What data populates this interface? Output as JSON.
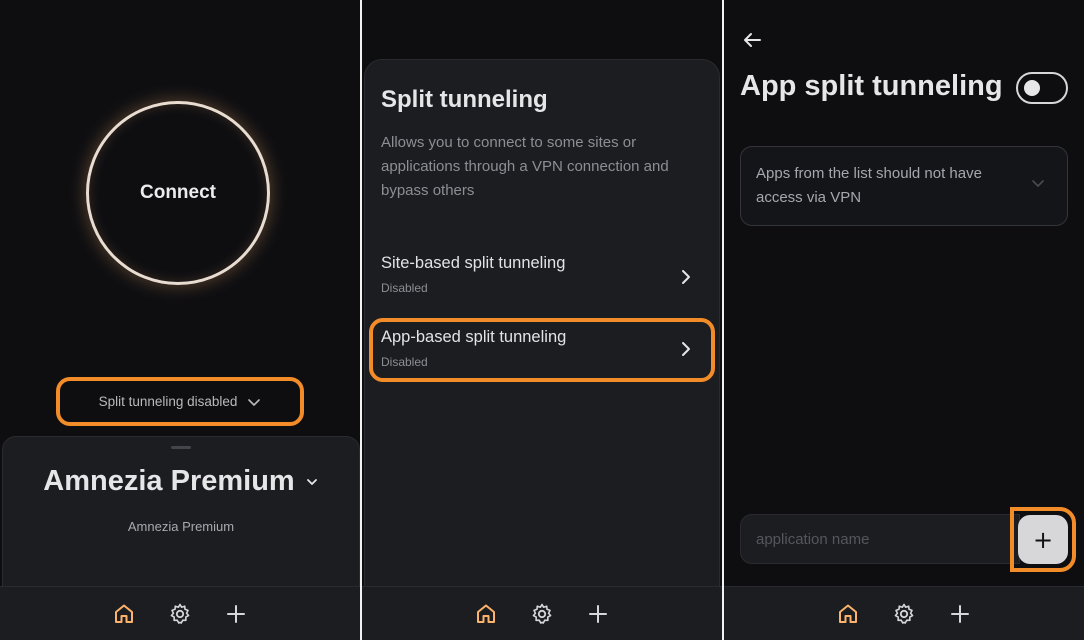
{
  "home": {
    "connect_label": "Connect",
    "split_tunneling_status": "Split tunneling disabled",
    "server_name": "Amnezia Premium",
    "server_subtitle": "Amnezia Premium"
  },
  "split_tunneling": {
    "title": "Split tunneling",
    "description": "Allows you to connect to some sites or applications through a VPN connection and bypass others",
    "options": [
      {
        "title": "Site-based split tunneling",
        "status": "Disabled"
      },
      {
        "title": "App-based split tunneling",
        "status": "Disabled"
      }
    ]
  },
  "app_split": {
    "title": "App split tunneling",
    "toggle_on": false,
    "mode_selected": "Apps from the list should not have access via VPN",
    "input_placeholder": "application name",
    "add_label": "+"
  },
  "nav": {
    "items": [
      "home-icon",
      "gear-icon",
      "plus-icon"
    ],
    "active": "home-icon"
  },
  "colors": {
    "accent": "#f28c28",
    "nav_active": "#fbb26a",
    "background": "#0e0e11",
    "surface": "#1c1d21"
  }
}
